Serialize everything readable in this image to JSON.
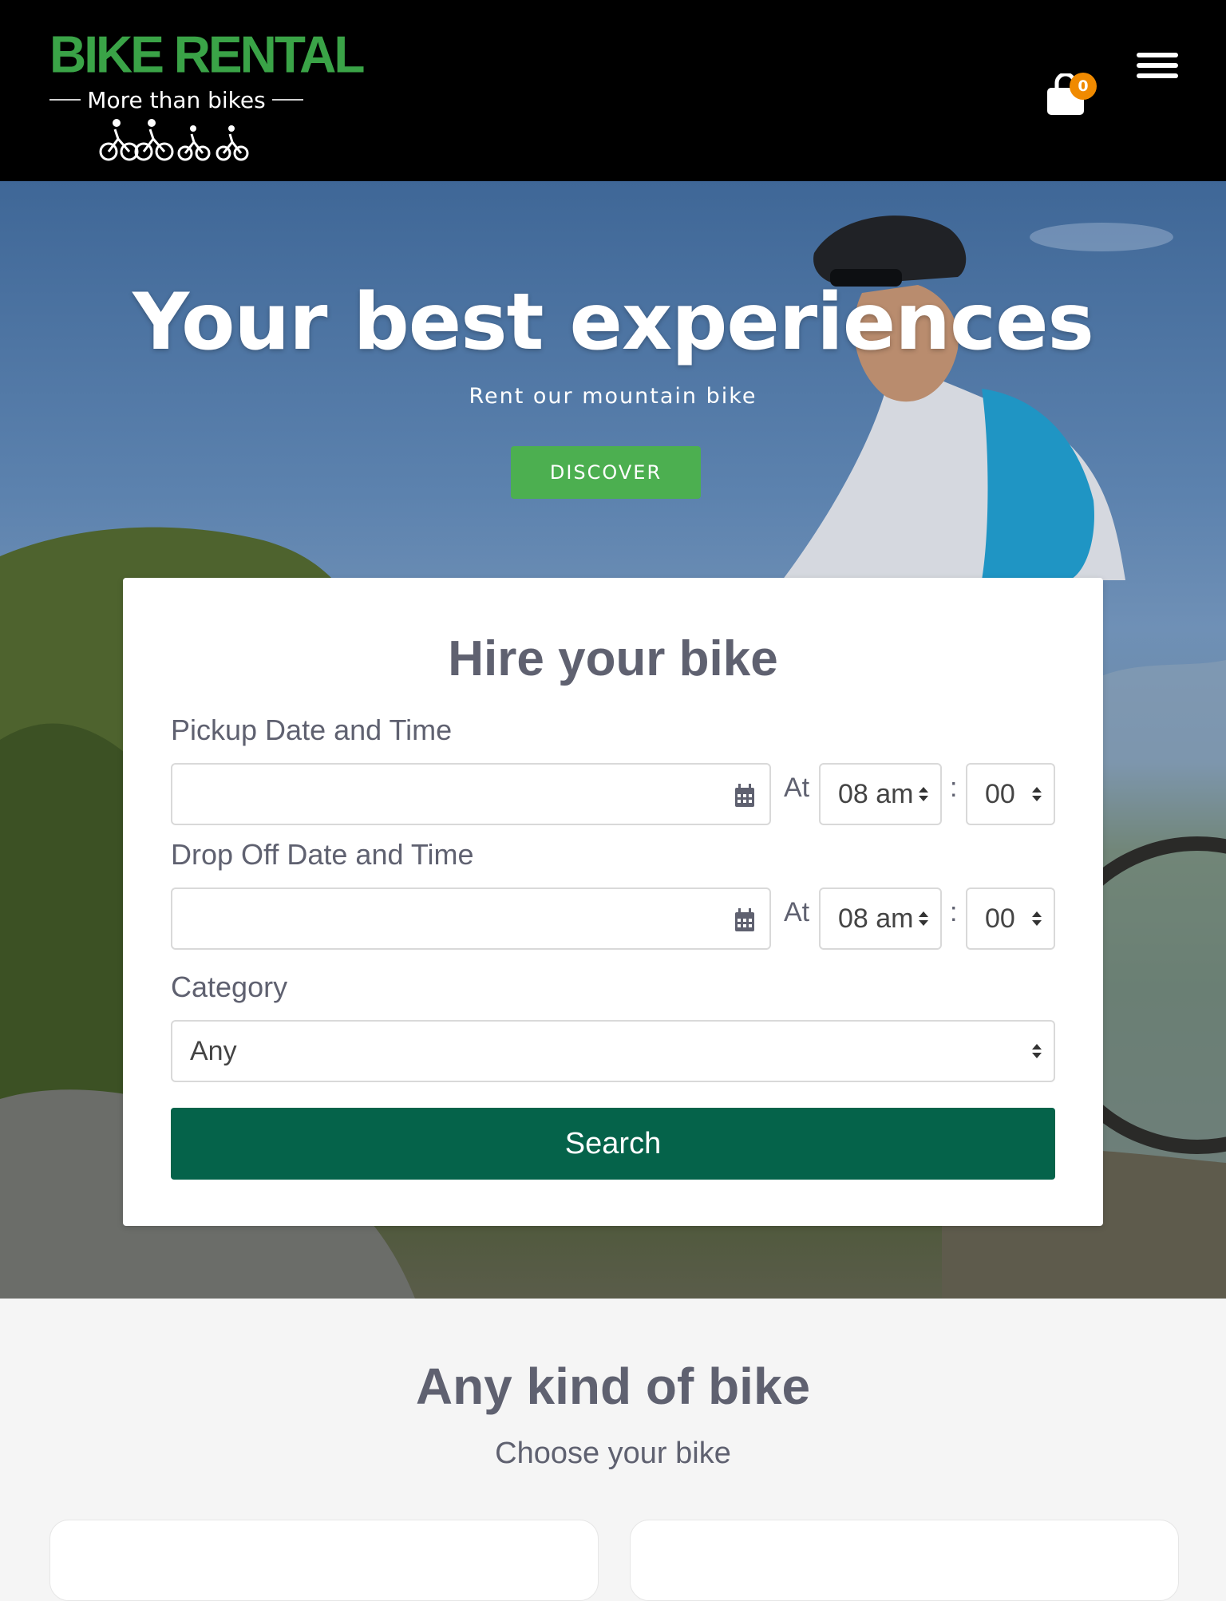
{
  "header": {
    "logo": {
      "title": "BIKE RENTAL",
      "tagline": "More than bikes"
    },
    "cart": {
      "icon": "shopping-bag-icon",
      "count": "0",
      "badge_color": "#f08a00"
    },
    "menu": {
      "icon": "hamburger-menu-icon"
    }
  },
  "hero": {
    "title": "Your best experiences",
    "subtitle": "Rent our mountain bike",
    "discover_label": "DISCOVER",
    "discover_color": "#4caf50"
  },
  "booking": {
    "title": "Hire your bike",
    "pickup": {
      "label": "Pickup Date and Time",
      "date_value": "",
      "at_label": "At",
      "hour": "08 am",
      "separator": ":",
      "minute": "00"
    },
    "dropoff": {
      "label": "Drop Off Date and Time",
      "date_value": "",
      "at_label": "At",
      "hour": "08 am",
      "separator": ":",
      "minute": "00"
    },
    "category": {
      "label": "Category",
      "value": "Any"
    },
    "search_label": "Search",
    "search_color": "#05634a",
    "calendar_icon": "calendar-icon"
  },
  "lower": {
    "title": "Any kind of bike",
    "subtitle": "Choose your bike"
  }
}
